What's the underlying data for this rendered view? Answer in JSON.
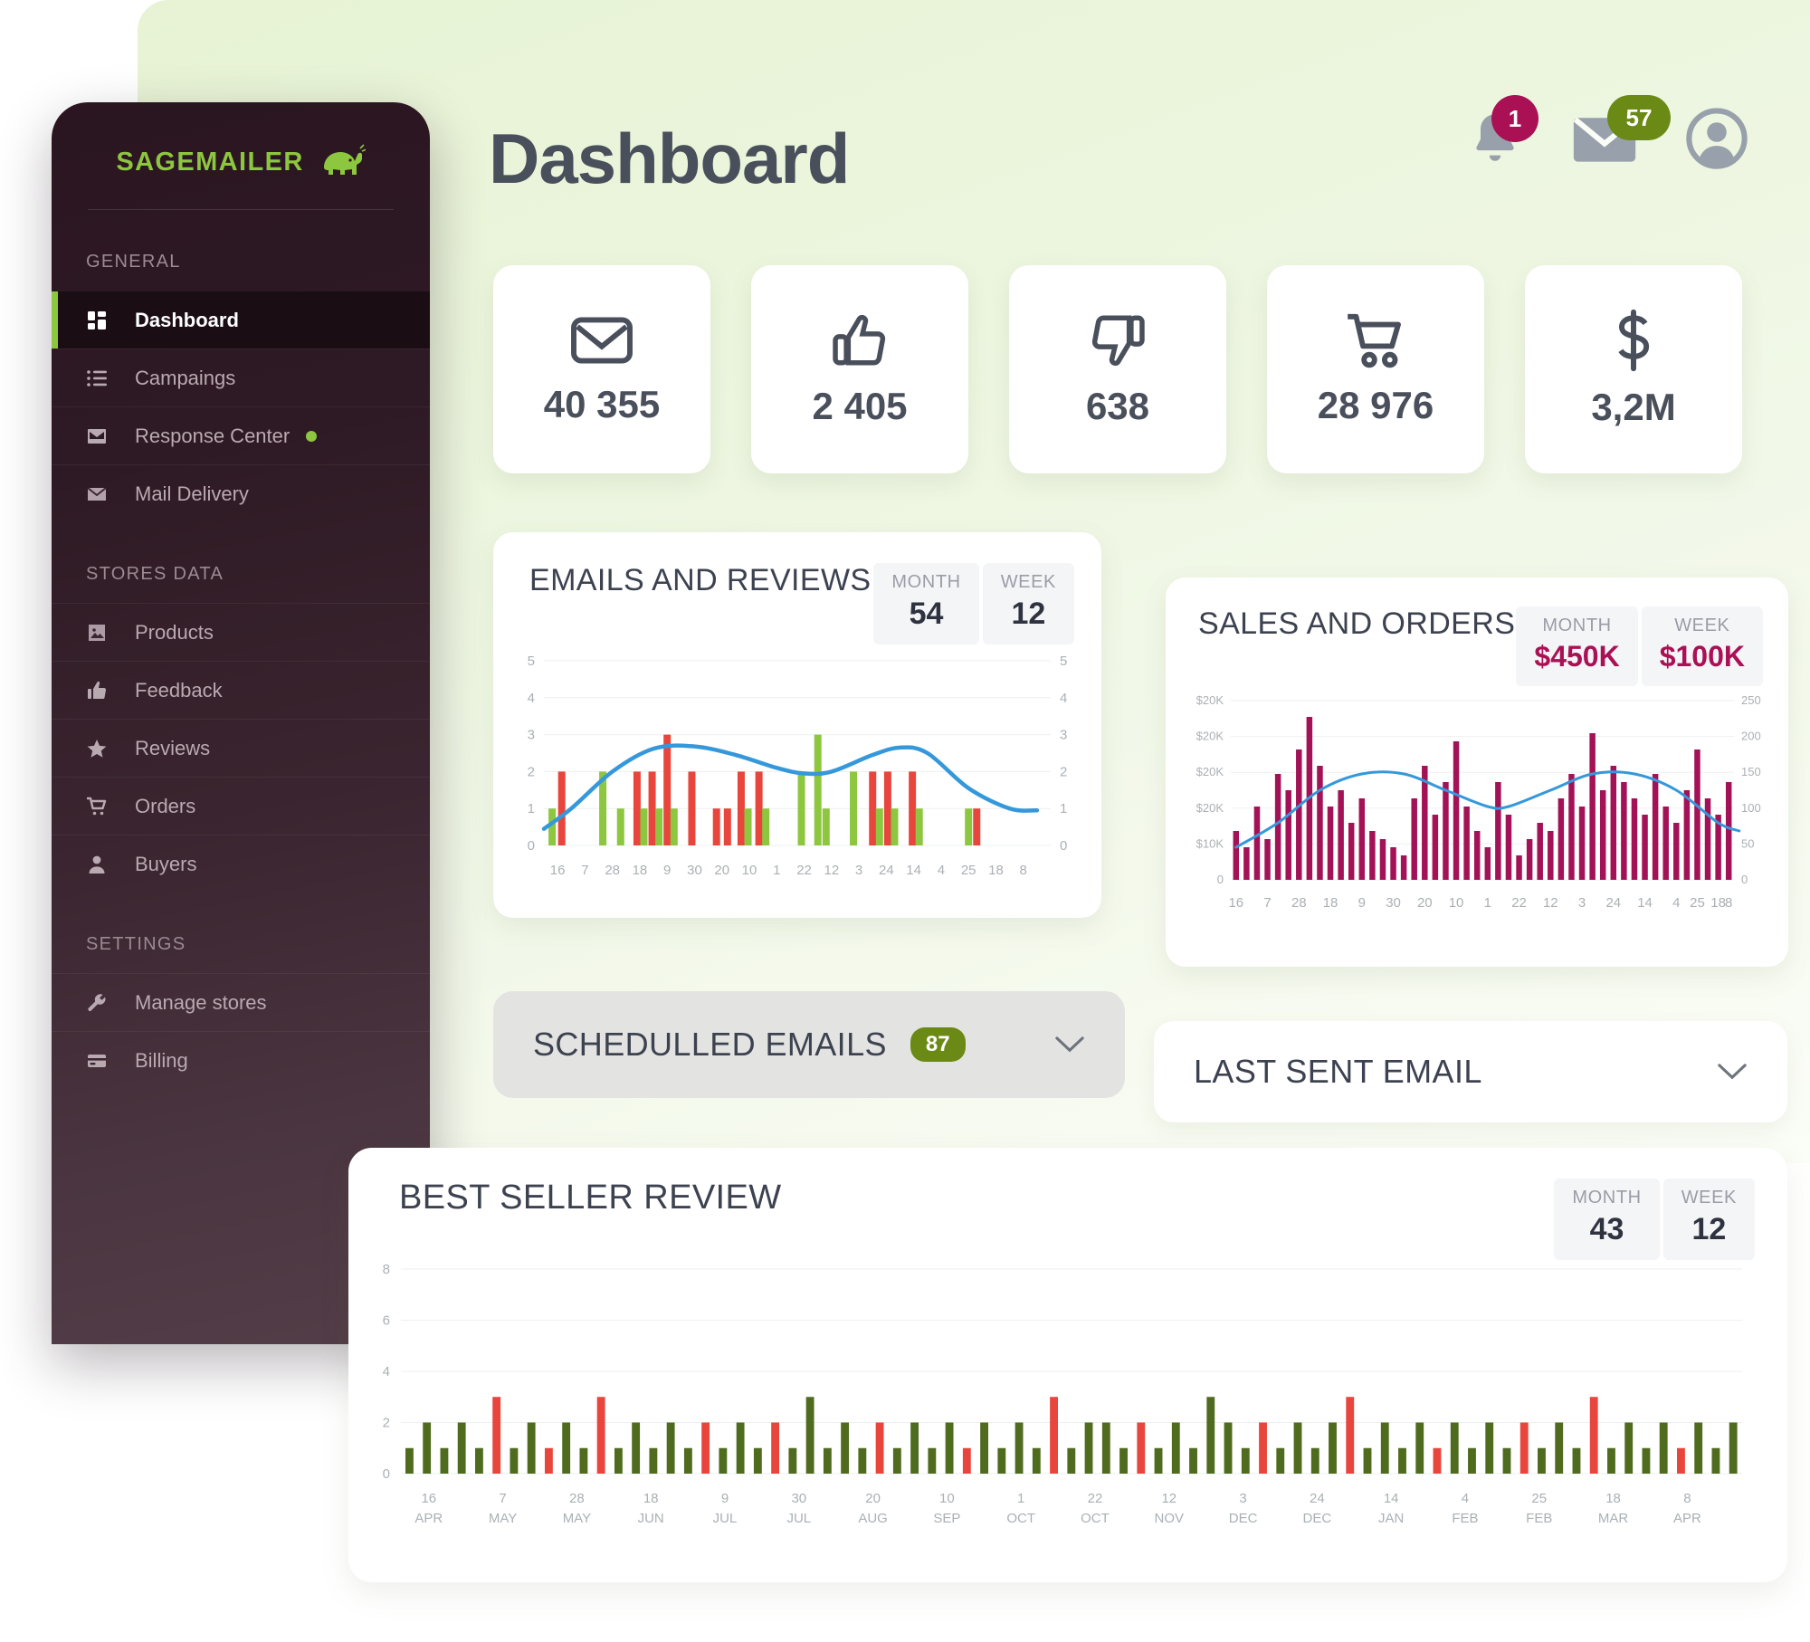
{
  "brand": {
    "name": "SAGEMAILER",
    "logo_icon": "elephant-icon"
  },
  "header": {
    "title": "Dashboard",
    "notifications": {
      "icon": "bell-icon",
      "count": "1",
      "color": "#aa1155"
    },
    "messages": {
      "icon": "envelope-icon",
      "count": "57",
      "color": "#6b8a15"
    },
    "avatar": {
      "icon": "user-avatar-icon"
    }
  },
  "sidebar": {
    "sections": [
      {
        "label": "GENERAL",
        "items": [
          {
            "label": "Dashboard",
            "icon": "grid-icon",
            "active": true
          },
          {
            "label": "Campaings",
            "icon": "list-icon",
            "active": false
          },
          {
            "label": "Response Center",
            "icon": "inbox-icon",
            "active": false,
            "dot": true
          },
          {
            "label": "Mail Delivery",
            "icon": "envelope-icon",
            "active": false
          }
        ]
      },
      {
        "label": "STORES DATA",
        "items": [
          {
            "label": "Products",
            "icon": "image-icon",
            "active": false
          },
          {
            "label": "Feedback",
            "icon": "thumbs-up-icon",
            "active": false
          },
          {
            "label": "Reviews",
            "icon": "star-icon",
            "active": false
          },
          {
            "label": "Orders",
            "icon": "cart-icon",
            "active": false
          },
          {
            "label": "Buyers",
            "icon": "person-icon",
            "active": false
          }
        ]
      },
      {
        "label": "SETTINGS",
        "items": [
          {
            "label": "Manage stores",
            "icon": "wrench-icon",
            "active": false
          },
          {
            "label": "Billing",
            "icon": "credit-card-icon",
            "active": false
          }
        ]
      }
    ]
  },
  "kpis": [
    {
      "icon": "envelope-icon",
      "value": "40 355"
    },
    {
      "icon": "thumbs-up-icon",
      "value": "2 405"
    },
    {
      "icon": "thumbs-down-icon",
      "value": "638"
    },
    {
      "icon": "cart-icon",
      "value": "28 976"
    },
    {
      "icon": "dollar-icon",
      "value": "3,2M"
    }
  ],
  "emails_card": {
    "title": "EMAILS AND REVIEWS",
    "month_label": "MONTH",
    "month_value": "54",
    "week_label": "WEEK",
    "week_value": "12"
  },
  "sales_card": {
    "title": "SALES AND ORDERS",
    "month_label": "MONTH",
    "month_value": "$450K",
    "week_label": "WEEK",
    "week_value": "$100K"
  },
  "scheduled": {
    "title": "SCHEDULLED EMAILS",
    "count": "87",
    "chevron": "chevron-down-icon"
  },
  "last_sent": {
    "title": "LAST SENT EMAIL",
    "chevron": "chevron-down-icon"
  },
  "best_seller": {
    "title": "BEST SELLER REVIEW",
    "month_label": "MONTH",
    "month_value": "43",
    "week_label": "WEEK",
    "week_value": "12"
  },
  "chart_data": [
    {
      "id": "emails_and_reviews",
      "type": "bar",
      "title": "EMAILS AND REVIEWS",
      "xlabel": "",
      "ylabel": "",
      "ylim": [
        0,
        5
      ],
      "yticks": [
        0,
        1,
        2,
        3,
        4,
        5
      ],
      "right_axis": true,
      "grid": true,
      "legend": "none",
      "categories": [
        "16",
        "7",
        "28",
        "18",
        "9",
        "30",
        "20",
        "10",
        "1",
        "22",
        "12",
        "3",
        "24",
        "14",
        "4",
        "25",
        "18",
        "8"
      ],
      "tick_positions": [
        1,
        3,
        5,
        7,
        9,
        11,
        13,
        15,
        17,
        19,
        21,
        23,
        25,
        27,
        29,
        31,
        33,
        35
      ],
      "colors": {
        "green": "#8dc63f",
        "red": "#e8453c",
        "line": "#3498db"
      },
      "bars": [
        {
          "x": 0.6,
          "v": 1,
          "c": "green"
        },
        {
          "x": 1.3,
          "v": 2,
          "c": "red"
        },
        {
          "x": 4.3,
          "v": 2,
          "c": "green"
        },
        {
          "x": 5.6,
          "v": 1,
          "c": "green"
        },
        {
          "x": 6.8,
          "v": 2,
          "c": "red"
        },
        {
          "x": 7.3,
          "v": 1,
          "c": "green"
        },
        {
          "x": 7.9,
          "v": 2,
          "c": "red"
        },
        {
          "x": 8.4,
          "v": 1,
          "c": "green"
        },
        {
          "x": 9.0,
          "v": 3,
          "c": "red"
        },
        {
          "x": 9.5,
          "v": 1,
          "c": "green"
        },
        {
          "x": 10.8,
          "v": 2,
          "c": "red"
        },
        {
          "x": 12.6,
          "v": 1,
          "c": "red"
        },
        {
          "x": 13.4,
          "v": 1,
          "c": "red"
        },
        {
          "x": 14.4,
          "v": 2,
          "c": "red"
        },
        {
          "x": 14.9,
          "v": 1,
          "c": "green"
        },
        {
          "x": 15.7,
          "v": 2,
          "c": "red"
        },
        {
          "x": 16.2,
          "v": 1,
          "c": "green"
        },
        {
          "x": 18.8,
          "v": 2,
          "c": "green"
        },
        {
          "x": 20.0,
          "v": 3,
          "c": "green"
        },
        {
          "x": 20.6,
          "v": 1,
          "c": "green"
        },
        {
          "x": 22.6,
          "v": 2,
          "c": "green"
        },
        {
          "x": 24.0,
          "v": 2,
          "c": "red"
        },
        {
          "x": 24.5,
          "v": 1,
          "c": "green"
        },
        {
          "x": 25.1,
          "v": 2,
          "c": "red"
        },
        {
          "x": 25.6,
          "v": 1,
          "c": "green"
        },
        {
          "x": 26.9,
          "v": 2,
          "c": "red"
        },
        {
          "x": 27.4,
          "v": 1,
          "c": "green"
        },
        {
          "x": 31.0,
          "v": 1,
          "c": "green"
        },
        {
          "x": 31.6,
          "v": 1,
          "c": "red"
        }
      ],
      "line_series": {
        "name": "trend",
        "color": "#3498db",
        "points": [
          [
            0,
            0.45
          ],
          [
            2,
            1.0
          ],
          [
            5,
            2.0
          ],
          [
            8,
            2.62
          ],
          [
            11,
            2.68
          ],
          [
            14,
            2.45
          ],
          [
            17,
            2.1
          ],
          [
            19,
            1.95
          ],
          [
            21,
            2.0
          ],
          [
            24,
            2.45
          ],
          [
            26,
            2.65
          ],
          [
            28,
            2.5
          ],
          [
            31,
            1.55
          ],
          [
            34,
            1.0
          ],
          [
            36,
            0.95
          ]
        ]
      }
    },
    {
      "id": "sales_and_orders",
      "type": "bar",
      "title": "SALES AND ORDERS",
      "ylim": [
        0,
        25000
      ],
      "yticks_left": [
        "0",
        "$10K",
        "$20K",
        "$20K",
        "$20K",
        "$20K"
      ],
      "yticks_right": [
        "0",
        "50",
        "100",
        "150",
        "200",
        "250"
      ],
      "right_axis": true,
      "grid": true,
      "categories": [
        "16",
        "7",
        "28",
        "18",
        "9",
        "30",
        "20",
        "10",
        "1",
        "22",
        "12",
        "3",
        "24",
        "14",
        "4",
        "25",
        "18",
        "8"
      ],
      "colors": {
        "bar": "#a31256",
        "line": "#3498db"
      },
      "bars": [
        6,
        4,
        9,
        5,
        13,
        11,
        16,
        20,
        14,
        9,
        11,
        7,
        10,
        6,
        5,
        4,
        3,
        10,
        14,
        8,
        12,
        17,
        9,
        6,
        4,
        12,
        8,
        3,
        5,
        7,
        6,
        10,
        13,
        9,
        18,
        11,
        14,
        12,
        10,
        8,
        13,
        9,
        7,
        11,
        16,
        10,
        8,
        12
      ],
      "line_series": {
        "name": "trend",
        "color": "#3498db",
        "points": [
          [
            0,
            4
          ],
          [
            4,
            7
          ],
          [
            8,
            11
          ],
          [
            12,
            13
          ],
          [
            16,
            13
          ],
          [
            20,
            11
          ],
          [
            24,
            9
          ],
          [
            26,
            9
          ],
          [
            30,
            11
          ],
          [
            34,
            13
          ],
          [
            38,
            13
          ],
          [
            42,
            11
          ],
          [
            46,
            7
          ],
          [
            48,
            6
          ]
        ]
      }
    },
    {
      "id": "best_seller_review",
      "type": "bar",
      "title": "BEST SELLER REVIEW",
      "ylim": [
        0,
        8
      ],
      "yticks": [
        0,
        2,
        4,
        6,
        8
      ],
      "grid": true,
      "colors": {
        "green": "#4f6b1e",
        "red": "#e8453c"
      },
      "categories": [
        {
          "d": "16",
          "m": "APR"
        },
        {
          "d": "7",
          "m": "MAY"
        },
        {
          "d": "28",
          "m": "MAY"
        },
        {
          "d": "18",
          "m": "JUN"
        },
        {
          "d": "9",
          "m": "JUL"
        },
        {
          "d": "30",
          "m": "JUL"
        },
        {
          "d": "20",
          "m": "AUG"
        },
        {
          "d": "10",
          "m": "SEP"
        },
        {
          "d": "1",
          "m": "OCT"
        },
        {
          "d": "22",
          "m": "OCT"
        },
        {
          "d": "12",
          "m": "NOV"
        },
        {
          "d": "3",
          "m": "DEC"
        },
        {
          "d": "24",
          "m": "DEC"
        },
        {
          "d": "14",
          "m": "JAN"
        },
        {
          "d": "4",
          "m": "FEB"
        },
        {
          "d": "25",
          "m": "FEB"
        },
        {
          "d": "18",
          "m": "MAR"
        },
        {
          "d": "8",
          "m": "APR"
        }
      ],
      "bars": [
        {
          "v": 1,
          "c": "green"
        },
        {
          "v": 2,
          "c": "green"
        },
        {
          "v": 1,
          "c": "green"
        },
        {
          "v": 2,
          "c": "green"
        },
        {
          "v": 1,
          "c": "green"
        },
        {
          "v": 3,
          "c": "red"
        },
        {
          "v": 1,
          "c": "green"
        },
        {
          "v": 2,
          "c": "green"
        },
        {
          "v": 1,
          "c": "red"
        },
        {
          "v": 2,
          "c": "green"
        },
        {
          "v": 1,
          "c": "green"
        },
        {
          "v": 3,
          "c": "red"
        },
        {
          "v": 1,
          "c": "green"
        },
        {
          "v": 2,
          "c": "green"
        },
        {
          "v": 1,
          "c": "green"
        },
        {
          "v": 2,
          "c": "green"
        },
        {
          "v": 1,
          "c": "green"
        },
        {
          "v": 2,
          "c": "red"
        },
        {
          "v": 1,
          "c": "green"
        },
        {
          "v": 2,
          "c": "green"
        },
        {
          "v": 1,
          "c": "green"
        },
        {
          "v": 2,
          "c": "red"
        },
        {
          "v": 1,
          "c": "green"
        },
        {
          "v": 3,
          "c": "green"
        },
        {
          "v": 1,
          "c": "green"
        },
        {
          "v": 2,
          "c": "green"
        },
        {
          "v": 1,
          "c": "green"
        },
        {
          "v": 2,
          "c": "red"
        },
        {
          "v": 1,
          "c": "green"
        },
        {
          "v": 2,
          "c": "green"
        },
        {
          "v": 1,
          "c": "green"
        },
        {
          "v": 2,
          "c": "green"
        },
        {
          "v": 1,
          "c": "red"
        },
        {
          "v": 2,
          "c": "green"
        },
        {
          "v": 1,
          "c": "green"
        },
        {
          "v": 2,
          "c": "green"
        },
        {
          "v": 1,
          "c": "green"
        },
        {
          "v": 3,
          "c": "red"
        },
        {
          "v": 1,
          "c": "green"
        },
        {
          "v": 2,
          "c": "green"
        },
        {
          "v": 2,
          "c": "green"
        },
        {
          "v": 1,
          "c": "green"
        },
        {
          "v": 2,
          "c": "red"
        },
        {
          "v": 1,
          "c": "green"
        },
        {
          "v": 2,
          "c": "green"
        },
        {
          "v": 1,
          "c": "green"
        },
        {
          "v": 3,
          "c": "green"
        },
        {
          "v": 2,
          "c": "green"
        },
        {
          "v": 1,
          "c": "green"
        },
        {
          "v": 2,
          "c": "red"
        },
        {
          "v": 1,
          "c": "green"
        },
        {
          "v": 2,
          "c": "green"
        },
        {
          "v": 1,
          "c": "green"
        },
        {
          "v": 2,
          "c": "green"
        },
        {
          "v": 3,
          "c": "red"
        },
        {
          "v": 1,
          "c": "green"
        },
        {
          "v": 2,
          "c": "green"
        },
        {
          "v": 1,
          "c": "green"
        },
        {
          "v": 2,
          "c": "green"
        },
        {
          "v": 1,
          "c": "red"
        },
        {
          "v": 2,
          "c": "green"
        },
        {
          "v": 1,
          "c": "green"
        },
        {
          "v": 2,
          "c": "green"
        },
        {
          "v": 1,
          "c": "green"
        },
        {
          "v": 2,
          "c": "red"
        },
        {
          "v": 1,
          "c": "green"
        },
        {
          "v": 2,
          "c": "green"
        },
        {
          "v": 1,
          "c": "green"
        },
        {
          "v": 3,
          "c": "red"
        },
        {
          "v": 1,
          "c": "green"
        },
        {
          "v": 2,
          "c": "green"
        },
        {
          "v": 1,
          "c": "green"
        },
        {
          "v": 2,
          "c": "green"
        },
        {
          "v": 1,
          "c": "red"
        },
        {
          "v": 2,
          "c": "green"
        },
        {
          "v": 1,
          "c": "green"
        },
        {
          "v": 2,
          "c": "green"
        }
      ]
    }
  ]
}
